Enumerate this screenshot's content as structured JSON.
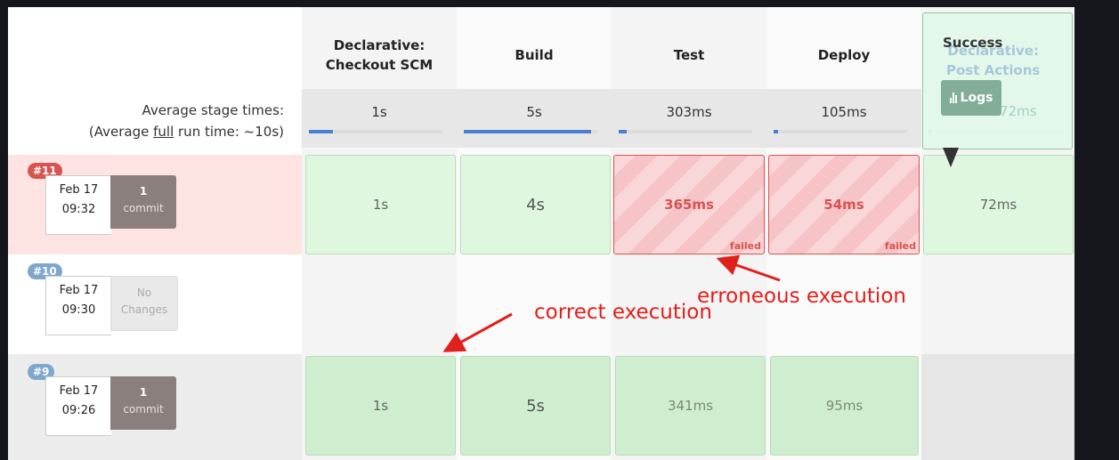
{
  "stages": [
    {
      "name": "Declarative: Checkout SCM",
      "avg": "1s",
      "avg_fill": 0.18
    },
    {
      "name": "Build",
      "avg": "5s",
      "avg_fill": 0.95
    },
    {
      "name": "Test",
      "avg": "303ms",
      "avg_fill": 0.06
    },
    {
      "name": "Deploy",
      "avg": "105ms",
      "avg_fill": 0.03
    },
    {
      "name": "Declarative: Post Actions",
      "avg": "72ms",
      "avg_fill": 0.02
    }
  ],
  "avg_label": {
    "line1": "Average stage times:",
    "line2_prefix": "(Average ",
    "line2_underlined": "full",
    "line2_suffix": " run time: ~10s)"
  },
  "runs": [
    {
      "badge": "#11",
      "badge_color": "#d9534f",
      "date": "Feb 17",
      "time": "09:32",
      "commit_count": "1",
      "commit_label": "commit",
      "row_color": "#fde4e2",
      "cells": [
        {
          "value": "1s",
          "status": "success"
        },
        {
          "value": "4s",
          "status": "success"
        },
        {
          "value": "365ms",
          "status": "failed",
          "status_label": "failed"
        },
        {
          "value": "54ms",
          "status": "failed",
          "status_label": "failed"
        },
        {
          "value": "72ms",
          "status": "success"
        }
      ]
    },
    {
      "badge": "#10",
      "badge_color": "#7fa6cc",
      "date": "Feb 17",
      "time": "09:30",
      "commit_count": "No",
      "commit_label": "Changes",
      "row_color": "#ffffff",
      "cells": []
    },
    {
      "badge": "#9",
      "badge_color": "#7fa6cc",
      "date": "Feb 17",
      "time": "09:26",
      "commit_count": "1",
      "commit_label": "commit",
      "row_color": "#ececec",
      "cells": [
        {
          "value": "1s",
          "status": "success"
        },
        {
          "value": "5s",
          "status": "success"
        },
        {
          "value": "341ms",
          "status": "success"
        },
        {
          "value": "95ms",
          "status": "success"
        }
      ]
    }
  ],
  "popup": {
    "title": "Success",
    "button": "Logs",
    "icon": "bar-chart-icon",
    "ghost_line1": "Declarative:",
    "ghost_line2": "Post Actions",
    "ghost_value": "72ms"
  },
  "annotations": {
    "correct": "correct execution",
    "erroneous": "erroneous execution",
    "color": "#e0201b"
  }
}
